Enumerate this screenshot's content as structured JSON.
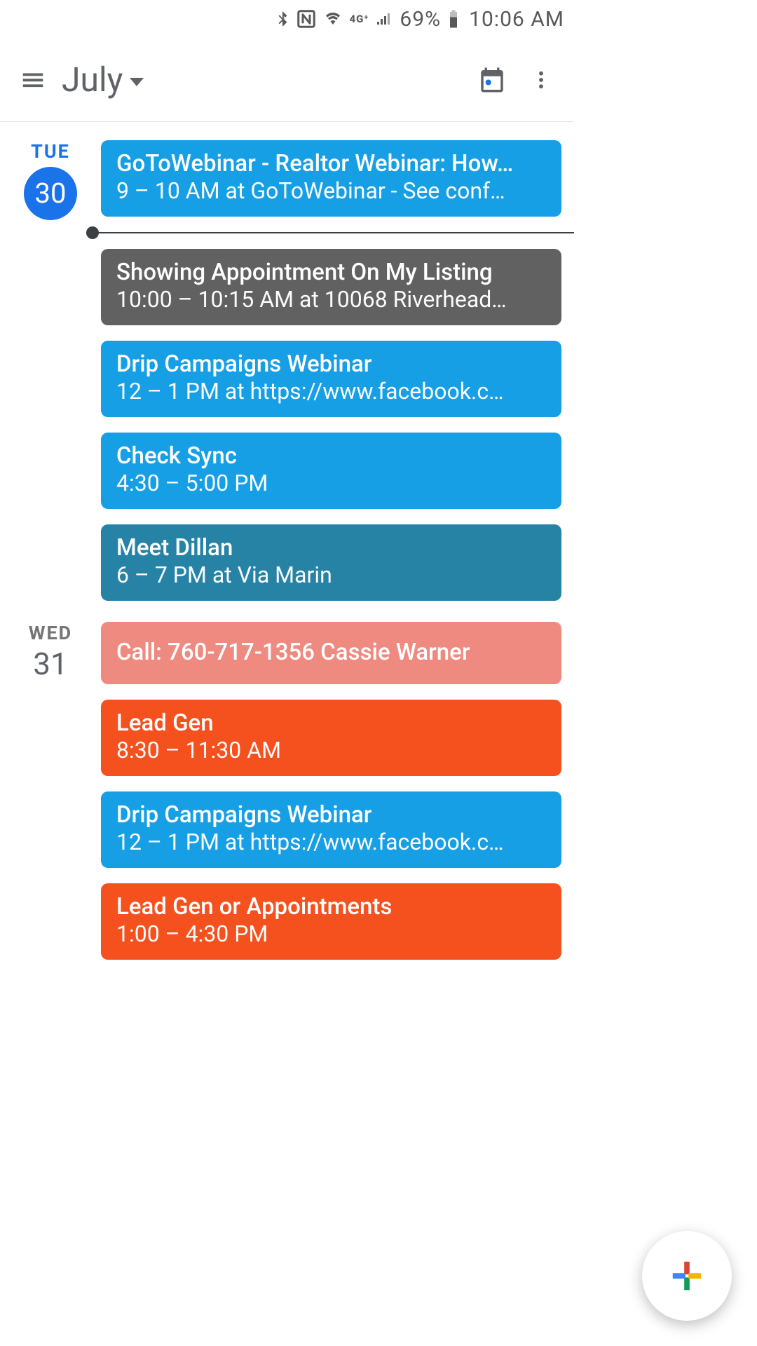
{
  "status": {
    "network": "4G",
    "battery_pct": "69%",
    "time": "10:06 AM"
  },
  "appbar": {
    "month": "July"
  },
  "days": [
    {
      "dow": "TUE",
      "num": "30",
      "is_today": true,
      "events": [
        {
          "title": "GoToWebinar - Realtor Webinar: How…",
          "detail": "9 – 10 AM at GoToWebinar - See conf…",
          "color": "c-blue",
          "now_after": true
        },
        {
          "title": "Showing Appointment On My Listing",
          "detail": "10:00 – 10:15 AM at 10068 Riverhead…",
          "color": "c-grey"
        },
        {
          "title": "Drip Campaigns Webinar",
          "detail": "12 – 1 PM at https://www.facebook.c…",
          "color": "c-blue"
        },
        {
          "title": "Check Sync",
          "detail": "4:30 – 5:00 PM",
          "color": "c-blue"
        },
        {
          "title": "Meet Dillan",
          "detail": "6 – 7 PM at Via Marin",
          "color": "c-teal"
        }
      ]
    },
    {
      "dow": "WED",
      "num": "31",
      "is_today": false,
      "events": [
        {
          "title": "Call: 760-717-1356 Cassie Warner",
          "detail": "",
          "color": "c-salmon",
          "single": true
        },
        {
          "title": "Lead Gen",
          "detail": "8:30 – 11:30 AM",
          "color": "c-orange"
        },
        {
          "title": "Drip Campaigns Webinar",
          "detail": "12 – 1 PM at https://www.facebook.c…",
          "color": "c-blue"
        },
        {
          "title": "Lead Gen or Appointments",
          "detail": "1:00 – 4:30 PM",
          "color": "c-orange"
        }
      ]
    }
  ]
}
